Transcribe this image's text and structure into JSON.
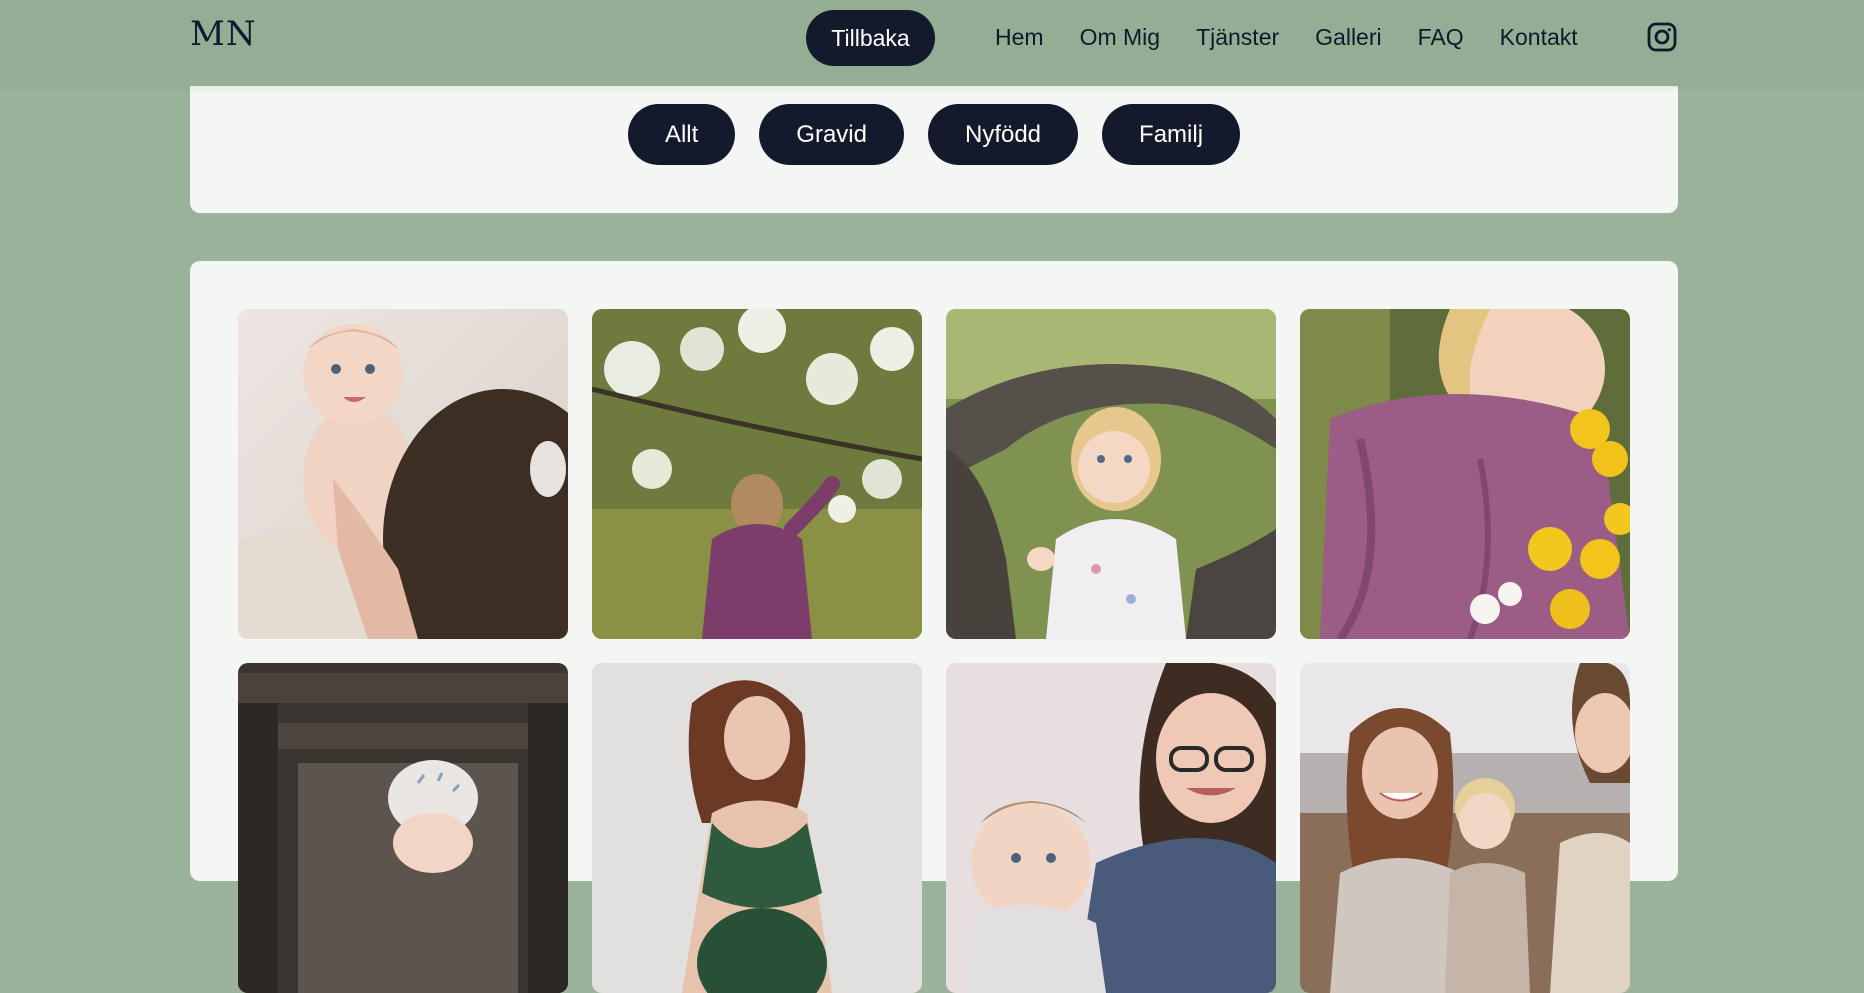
{
  "header": {
    "logo": "MN",
    "back_label": "Tillbaka",
    "nav": [
      "Hem",
      "Om Mig",
      "Tjänster",
      "Galleri",
      "FAQ",
      "Kontakt"
    ],
    "social_icon": "instagram-icon"
  },
  "filters": [
    "Allt",
    "Gravid",
    "Nyfödd",
    "Familj"
  ],
  "gallery": {
    "photos": [
      {
        "subject": "baby-with-parent-photo"
      },
      {
        "subject": "toddler-under-blossom-tree-photo"
      },
      {
        "subject": "toddler-by-tree-trunk-photo"
      },
      {
        "subject": "child-smelling-dandelions-photo"
      },
      {
        "subject": "baby-in-wooden-crib-photo"
      },
      {
        "subject": "pregnant-woman-photo"
      },
      {
        "subject": "mother-with-baby-photo"
      },
      {
        "subject": "family-outdoors-photo"
      }
    ]
  },
  "colors": {
    "background": "#9cb39b",
    "header": "#95ad94",
    "panel": "#f4f6f3",
    "button": "#121a2b",
    "text": "#0f1a2a"
  }
}
